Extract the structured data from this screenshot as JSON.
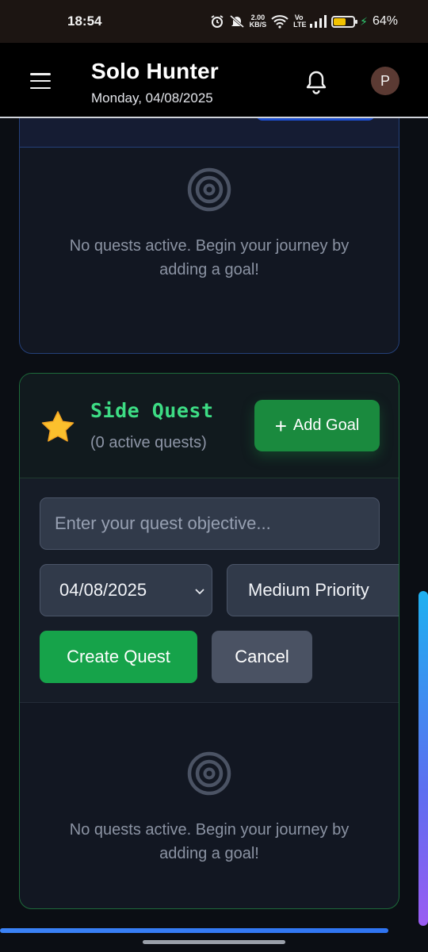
{
  "status_bar": {
    "time": "18:54",
    "net_speed_value": "2.00",
    "net_speed_unit": "KB/S",
    "volte": "Vo LTE",
    "battery_percent": "64%",
    "battery_level": 0.64,
    "icons": [
      "alarm-icon",
      "mute-icon",
      "wifi-icon",
      "signal-icon",
      "battery-icon",
      "charging-icon"
    ]
  },
  "header": {
    "title": "Solo Hunter",
    "date": "Monday, 04/08/2025",
    "avatar_initial": "P",
    "icons": [
      "menu-icon",
      "bell-icon"
    ]
  },
  "main_quest_card": {
    "empty_message": "No quests active. Begin your journey by adding a goal!"
  },
  "side_quest_card": {
    "title": "Side Quest",
    "count_text": "(0 active quests)",
    "add_goal_label": "+ Add Goal",
    "add_goal_text": "Add Goal",
    "add_goal_plus": "+",
    "form": {
      "objective_placeholder": "Enter your quest objective...",
      "objective_value": "",
      "date_value": "04/08/2025",
      "priority_value": "Medium Priority",
      "create_label": "Create Quest",
      "cancel_label": "Cancel"
    },
    "empty_message": "No quests active. Begin your journey by adding a goal!"
  },
  "colors": {
    "accent_green": "#16a34a",
    "title_green": "#3ddc84",
    "main_card_border": "#24407a",
    "side_card_border": "#1d6b3a",
    "background": "#0b0e14"
  }
}
